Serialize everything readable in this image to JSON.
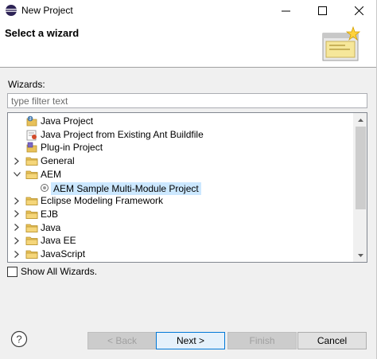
{
  "window": {
    "title": "New Project",
    "controls": {
      "minimize": "—",
      "maximize": "☐",
      "close": "✕"
    }
  },
  "header": {
    "title": "Select a wizard"
  },
  "wizards": {
    "label": "Wizards:",
    "filter_placeholder": "type filter text",
    "filter_value": ""
  },
  "tree": {
    "items": [
      {
        "label": "Java Project",
        "level": 1,
        "kind": "java-project-icon",
        "expander": ""
      },
      {
        "label": "Java Project from Existing Ant Buildfile",
        "level": 1,
        "kind": "ant-project-icon",
        "expander": ""
      },
      {
        "label": "Plug-in Project",
        "level": 1,
        "kind": "plugin-project-icon",
        "expander": ""
      },
      {
        "label": "General",
        "level": 0,
        "kind": "folder-icon",
        "expander": "collapsed"
      },
      {
        "label": "AEM",
        "level": 0,
        "kind": "folder-icon",
        "expander": "expanded"
      },
      {
        "label": "AEM Sample Multi-Module Project",
        "level": 1,
        "kind": "aem-project-icon",
        "expander": "",
        "selected": true
      },
      {
        "label": "Eclipse Modeling Framework",
        "level": 0,
        "kind": "folder-icon",
        "expander": "collapsed"
      },
      {
        "label": "EJB",
        "level": 0,
        "kind": "folder-icon",
        "expander": "collapsed"
      },
      {
        "label": "Java",
        "level": 0,
        "kind": "folder-icon",
        "expander": "collapsed"
      },
      {
        "label": "Java EE",
        "level": 0,
        "kind": "folder-icon",
        "expander": "collapsed"
      },
      {
        "label": "JavaScript",
        "level": 0,
        "kind": "folder-icon",
        "expander": "collapsed"
      }
    ]
  },
  "show_all": {
    "label": "Show All Wizards.",
    "checked": false
  },
  "buttons": {
    "back": "< Back",
    "next": "Next >",
    "finish": "Finish",
    "cancel": "Cancel"
  },
  "colors": {
    "selection": "#cce8ff",
    "dialog_bg": "#f0f0f0",
    "default_button_border": "#0078d7"
  }
}
